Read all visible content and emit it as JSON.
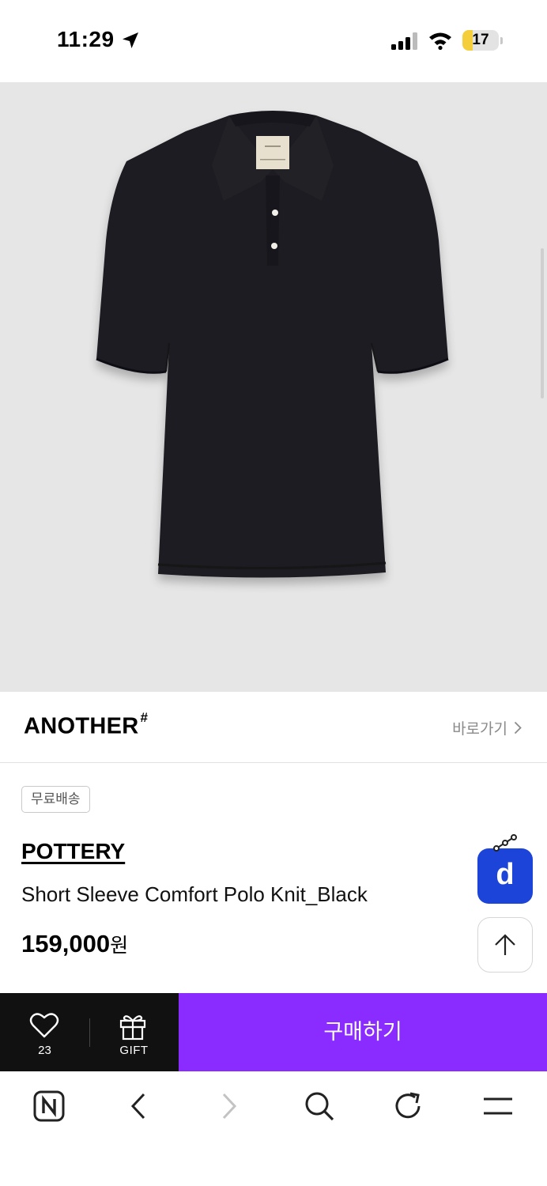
{
  "status_bar": {
    "time": "11:29",
    "battery_level": "17",
    "battery_fraction": 0.17,
    "icons": [
      "location-arrow-icon",
      "cellular-signal-icon",
      "wifi-icon",
      "battery-icon"
    ]
  },
  "product": {
    "image_alt": "black short sleeve polo knit",
    "brand_logo": "ANOTHER",
    "brand_logo_mark": "#",
    "brand_link_label": "바로가기",
    "shipping_badge": "무료배송",
    "brand": "POTTERY",
    "name": "Short Sleeve Comfort Polo Knit_Black",
    "price": "159,000",
    "price_unit": "원"
  },
  "floating": {
    "d_button_label": "d",
    "icons": [
      "share-graph-icon",
      "arrow-up-icon"
    ]
  },
  "action_bar": {
    "like_count": "23",
    "gift_label": "GIFT",
    "buy_label": "구매하기"
  },
  "browser_toolbar": {
    "icons": [
      "naver-n-icon",
      "back-icon",
      "forward-icon",
      "search-icon",
      "reload-icon",
      "menu-icon"
    ]
  },
  "colors": {
    "accent_purple": "#8a2bff",
    "d_button_blue": "#1d44d8",
    "battery_yellow": "#f5cf3b",
    "action_bar_dark": "#111111",
    "image_background": "#e6e6e6"
  }
}
